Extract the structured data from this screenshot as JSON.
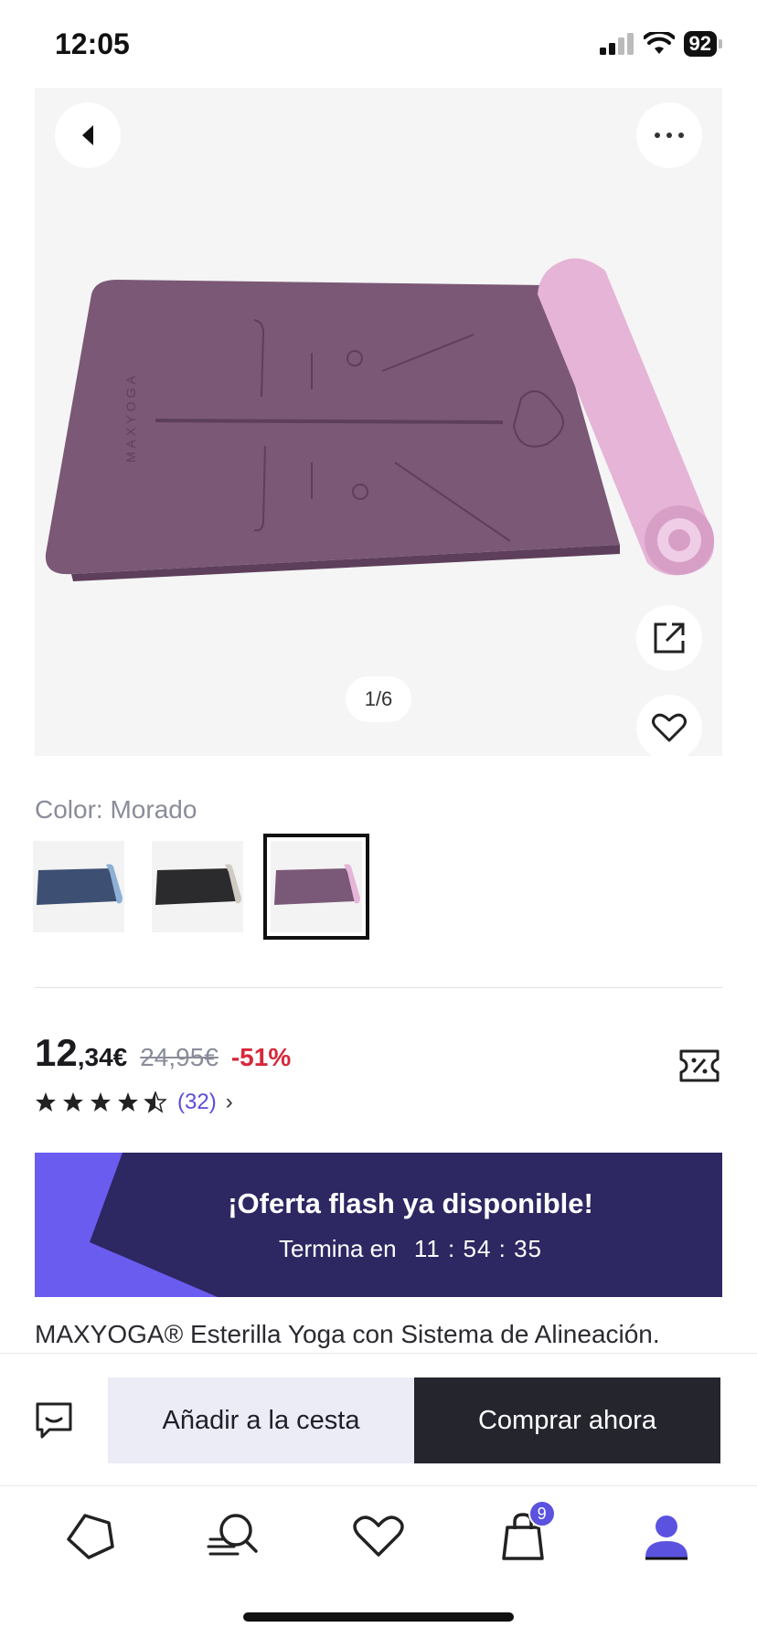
{
  "status_bar": {
    "time": "12:05",
    "battery": "92"
  },
  "product": {
    "image_counter": "1/6",
    "color_label": "Color: Morado",
    "swatches": [
      {
        "name": "Azul",
        "mat_color": "#3d4f73",
        "roll_color": "#8fb0d6"
      },
      {
        "name": "Negro",
        "mat_color": "#2b2b2e",
        "roll_color": "#cfcac2"
      },
      {
        "name": "Morado",
        "mat_color": "#7a5877",
        "roll_color": "#e6b6d8",
        "selected": true
      }
    ],
    "price_integer": "12",
    "price_decimal": ",34€",
    "price_old": "24,95€",
    "discount": "-51%",
    "rating": 4.5,
    "review_count": "(32)",
    "review_arrow": "›",
    "description": "MAXYOGA® Esterilla Yoga con Sistema de Alineación."
  },
  "flash": {
    "title": "¡Oferta flash ya disponible!",
    "ends_label": "Termina en",
    "timer": "11 : 54 : 35"
  },
  "actions": {
    "add_to_cart": "Añadir a la cesta",
    "buy_now": "Comprar ahora"
  },
  "tab_bar": {
    "items": [
      {
        "icon": "pentagon-icon",
        "name": "home"
      },
      {
        "icon": "search-icon",
        "name": "search"
      },
      {
        "icon": "heart-icon",
        "name": "favorites"
      },
      {
        "icon": "shopping-bag-icon",
        "name": "cart",
        "badge": "9"
      },
      {
        "icon": "user-icon",
        "name": "profile"
      }
    ]
  },
  "colors": {
    "accent": "#5b52e0",
    "flash_bg": "#2d2762",
    "discount": "#d6283b",
    "buy_bg": "#25252e"
  }
}
